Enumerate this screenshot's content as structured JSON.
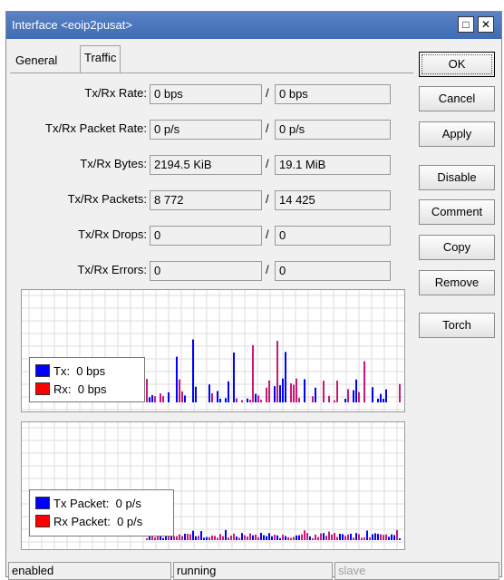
{
  "window": {
    "title": "Interface <eoip2pusat>"
  },
  "tabs": [
    {
      "label": "General"
    },
    {
      "label": "Traffic"
    }
  ],
  "rows": [
    {
      "label": "Tx/Rx Rate:",
      "tx": "0 bps",
      "rx": "0 bps"
    },
    {
      "label": "Tx/Rx Packet Rate:",
      "tx": "0 p/s",
      "rx": "0 p/s"
    },
    {
      "label": "Tx/Rx Bytes:",
      "tx": "2194.5 KiB",
      "rx": "19.1 MiB"
    },
    {
      "label": "Tx/Rx Packets:",
      "tx": "8 772",
      "rx": "14 425"
    },
    {
      "label": "Tx/Rx Drops:",
      "tx": "0",
      "rx": "0"
    },
    {
      "label": "Tx/Rx Errors:",
      "tx": "0",
      "rx": "0"
    }
  ],
  "separator": "/",
  "buttons": {
    "ok": "OK",
    "cancel": "Cancel",
    "apply": "Apply",
    "disable": "Disable",
    "comment": "Comment",
    "copy": "Copy",
    "remove": "Remove",
    "torch": "Torch"
  },
  "legend_rate": {
    "tx_label": "Tx:",
    "tx_value": "0 bps",
    "rx_label": "Rx:",
    "rx_value": "0 bps"
  },
  "legend_packet": {
    "tx_label": "Tx Packet:",
    "tx_value": "0 p/s",
    "rx_label": "Rx Packet:",
    "rx_value": "0 p/s"
  },
  "status": {
    "left": "enabled",
    "middle": "running",
    "right": "slave"
  },
  "colors": {
    "tx": "#0000ff",
    "rx": "#ff0000",
    "rx_bar": "#c8197a",
    "grid": "#dcdcdc",
    "title_bar": "#4a76bd"
  }
}
